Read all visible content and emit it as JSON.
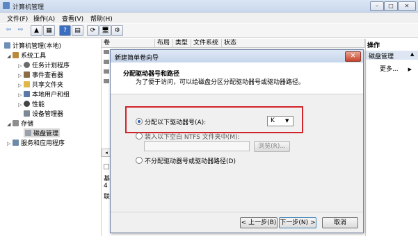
{
  "window": {
    "title": "计算机管理",
    "minimize": "–",
    "maximize": "□",
    "close": "✕"
  },
  "menu": [
    "文件(F)",
    "操作(A)",
    "查看(V)",
    "帮助(H)"
  ],
  "toolbar_glyphs": [
    "⇦",
    "⇨",
    "▲",
    "▦",
    "?",
    "▤",
    "⟳",
    "🖥",
    "⚙"
  ],
  "tree": {
    "root": "计算机管理(本地)",
    "system_tools": "系统工具",
    "task_scheduler": "任务计划程序",
    "event_viewer": "事件查看器",
    "shared_folders": "共享文件夹",
    "local_users": "本地用户和组",
    "performance": "性能",
    "device_manager": "设备管理器",
    "storage": "存储",
    "disk_management": "磁盘管理",
    "services_apps": "服务和应用程序"
  },
  "columns": [
    "卷",
    "布局",
    "类型",
    "文件系统",
    "状态"
  ],
  "list_fragments": [
    "基",
    "4",
    "联"
  ],
  "actions": {
    "header": "操作",
    "section": "磁盘管理",
    "more": "更多..."
  },
  "dialog": {
    "title": "新建简单卷向导",
    "close": "✕",
    "heading": "分配驱动器号和路径",
    "subheading": "为了便于访问，可以给磁盘分区分配驱动器号或驱动器路径。",
    "option1": "分配以下驱动器号(A):",
    "drive_letter": "K",
    "option2": "装入以下空白 NTFS 文件夹中(M):",
    "browse": "浏览(R)...",
    "option3": "不分配驱动器号或驱动器路径(D)",
    "back": "< 上一步(B)",
    "next": "下一步(N) >",
    "cancel": "取消"
  },
  "colors": {
    "highlight": "#d0242a",
    "titlebar": "#c9d8ee"
  }
}
